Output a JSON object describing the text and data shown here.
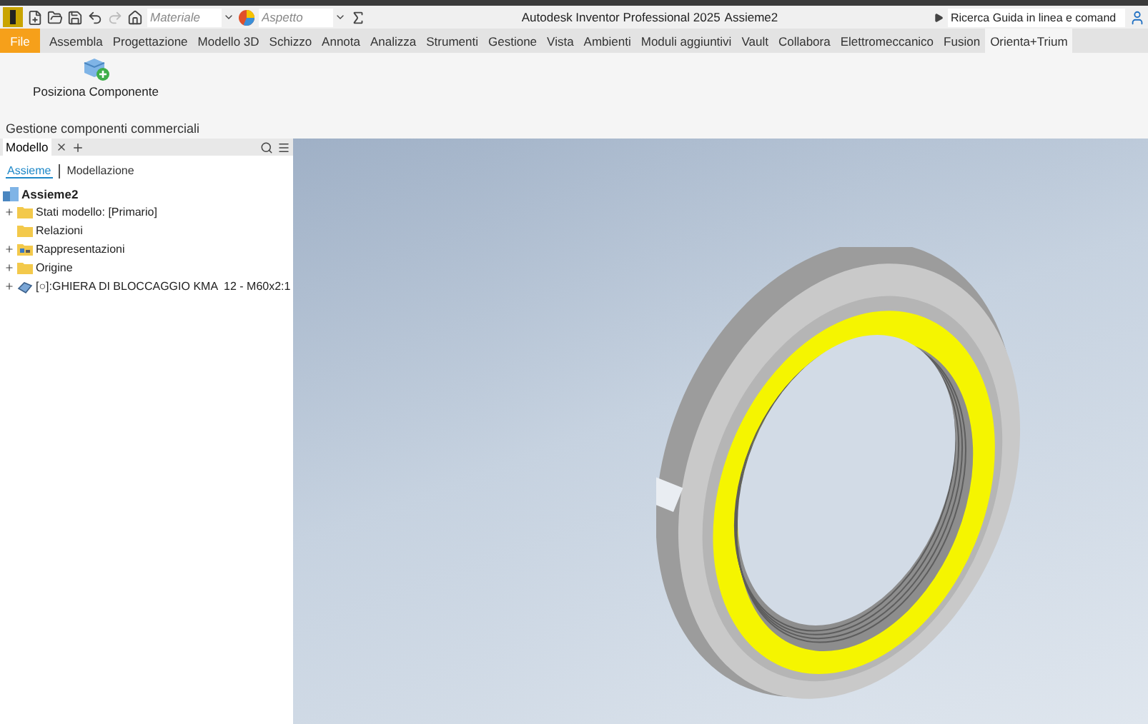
{
  "quick_access": {
    "material": {
      "placeholder": "Materiale"
    },
    "appearance": {
      "placeholder": "Aspetto"
    }
  },
  "title_bar": {
    "app": "Autodesk Inventor Professional 2025",
    "document": "Assieme2",
    "search": {
      "placeholder": "Ricerca Guida in linea e comand"
    }
  },
  "ribbon": {
    "file_button": "File",
    "tabs": [
      {
        "label": "Assembla",
        "selected": false
      },
      {
        "label": "Progettazione",
        "selected": false
      },
      {
        "label": "Modello 3D",
        "selected": false
      },
      {
        "label": "Schizzo",
        "selected": false
      },
      {
        "label": "Annota",
        "selected": false
      },
      {
        "label": "Analizza",
        "selected": false
      },
      {
        "label": "Strumenti",
        "selected": false
      },
      {
        "label": "Gestione",
        "selected": false
      },
      {
        "label": "Vista",
        "selected": false
      },
      {
        "label": "Ambienti",
        "selected": false
      },
      {
        "label": "Moduli aggiuntivi",
        "selected": false
      },
      {
        "label": "Vault",
        "selected": false
      },
      {
        "label": "Collabora",
        "selected": false
      },
      {
        "label": "Elettromeccanico",
        "selected": false
      },
      {
        "label": "Fusion",
        "selected": false
      },
      {
        "label": "Orienta+Trium",
        "selected": true
      }
    ],
    "commands": [
      {
        "label": "Posiziona Componente"
      }
    ],
    "panel_label": "Gestione componenti commerciali"
  },
  "browser": {
    "tab": "Modello",
    "subtabs": [
      {
        "label": "Assieme",
        "selected": true
      },
      {
        "label": "Modellazione",
        "selected": false
      }
    ],
    "root": "Assieme2",
    "items": [
      {
        "label": "Stati modello: [Primario]",
        "kind": "folder",
        "expandable": true
      },
      {
        "label": "Relazioni",
        "kind": "folder",
        "expandable": false
      },
      {
        "label": "Rappresentazioni",
        "kind": "representations",
        "expandable": true
      },
      {
        "label": "Origine",
        "kind": "folder",
        "expandable": true
      },
      {
        "label": "[○]:GHIERA DI BLOCCAGGIO KMA  12 - M60x2:1",
        "kind": "part",
        "expandable": true
      }
    ]
  }
}
